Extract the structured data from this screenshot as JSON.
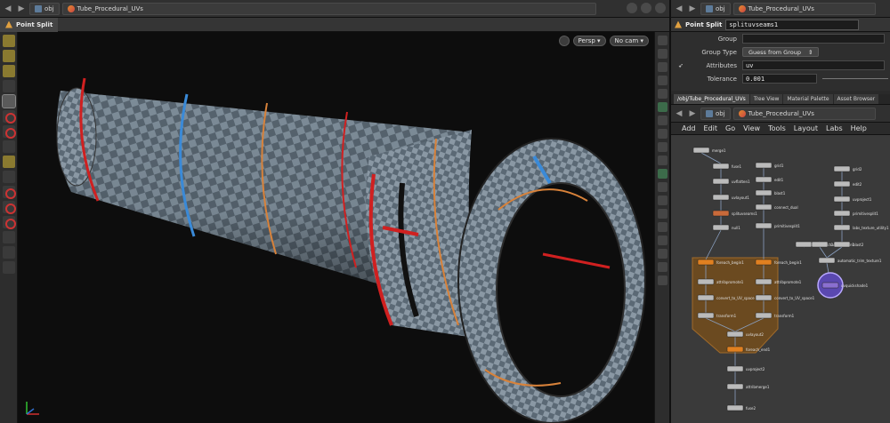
{
  "viewer": {
    "path_root": "obj",
    "path_node": "Tube_Procedural_UVs",
    "tab_label": "Point Split",
    "camera_menu": "Persp ▾",
    "cam_menu": "No cam ▾"
  },
  "params": {
    "node_type_label": "Point Split",
    "node_name": "splituvseams1",
    "group_label": "Group",
    "group_value": "",
    "group_type_label": "Group Type",
    "group_type_value": "Guess from Group",
    "attributes_label": "Attributes",
    "attributes_value": "uv",
    "tolerance_label": "Tolerance",
    "tolerance_value": "0.001"
  },
  "network": {
    "tabs": [
      "/obj/Tube_Procedural_UVs",
      "Tree View",
      "Material Palette",
      "Asset Browser"
    ],
    "path_root": "obj",
    "path_node": "Tube_Procedural_UVs",
    "menu": [
      "Add",
      "Edit",
      "Go",
      "View",
      "Tools",
      "Layout",
      "Labs",
      "Help"
    ],
    "nodes": [
      {
        "label": "merge1",
        "color": "#bbbbbb"
      },
      {
        "label": "fuse1",
        "color": "#bbbbbb"
      },
      {
        "label": "uvflatten1",
        "color": "#bbbbbb"
      },
      {
        "label": "uvlayout1",
        "color": "#bbbbbb"
      },
      {
        "label": "splituvseams1",
        "color": "#c96a3a"
      },
      {
        "label": "null1",
        "color": "#bbbbbb"
      },
      {
        "label": "grid1",
        "color": "#bbbbbb"
      },
      {
        "label": "edit1",
        "color": "#bbbbbb"
      },
      {
        "label": "blast1",
        "color": "#bbbbbb"
      },
      {
        "label": "connect_dual",
        "color": "#bbbbbb"
      },
      {
        "label": "primitivesplit1",
        "color": "#bbbbbb"
      },
      {
        "label": "uvproject1",
        "color": "#bbbbbb"
      },
      {
        "label": "grid2",
        "color": "#bbbbbb"
      },
      {
        "label": "edit2",
        "color": "#bbbbbb"
      },
      {
        "label": "uvproject1",
        "color": "#bbbbbb"
      },
      {
        "label": "primitivesplit1",
        "color": "#bbbbbb"
      },
      {
        "label": "labs_texture_utility1",
        "color": "#bbbbbb"
      },
      {
        "label": "uvtransform1",
        "color": "#bbbbbb"
      },
      {
        "label": "blast2",
        "color": "#bbbbbb"
      },
      {
        "label": "automatic_trim_texture1",
        "color": "#bbbbbb"
      },
      {
        "label": "uvquickshade1",
        "color": "#8a6fd0"
      },
      {
        "label": "foreach_begin1",
        "color": "#e08020"
      },
      {
        "label": "foreach_begin1",
        "color": "#e08020"
      },
      {
        "label": "attribpromote1",
        "color": "#bbbbbb"
      },
      {
        "label": "attribpromote1",
        "color": "#bbbbbb"
      },
      {
        "label": "convert_to_UV_space",
        "color": "#bbbbbb"
      },
      {
        "label": "convert_to_UV_space1",
        "color": "#bbbbbb"
      },
      {
        "label": "transform1",
        "color": "#bbbbbb"
      },
      {
        "label": "transform1",
        "color": "#bbbbbb"
      },
      {
        "label": "uvlayout2",
        "color": "#bbbbbb"
      },
      {
        "label": "foreach_end1",
        "color": "#e08020"
      },
      {
        "label": "uvproject2",
        "color": "#bbbbbb"
      },
      {
        "label": "attribmerge1",
        "color": "#bbbbbb"
      },
      {
        "label": "fuse2",
        "color": "#bbbbbb"
      }
    ]
  },
  "colors": {
    "accent_orange": "#e08020",
    "seam_red": "#d02020",
    "seam_blue": "#3a8ad8",
    "seam_orange": "#d8823a",
    "network_bg": "#3a3a3a"
  }
}
